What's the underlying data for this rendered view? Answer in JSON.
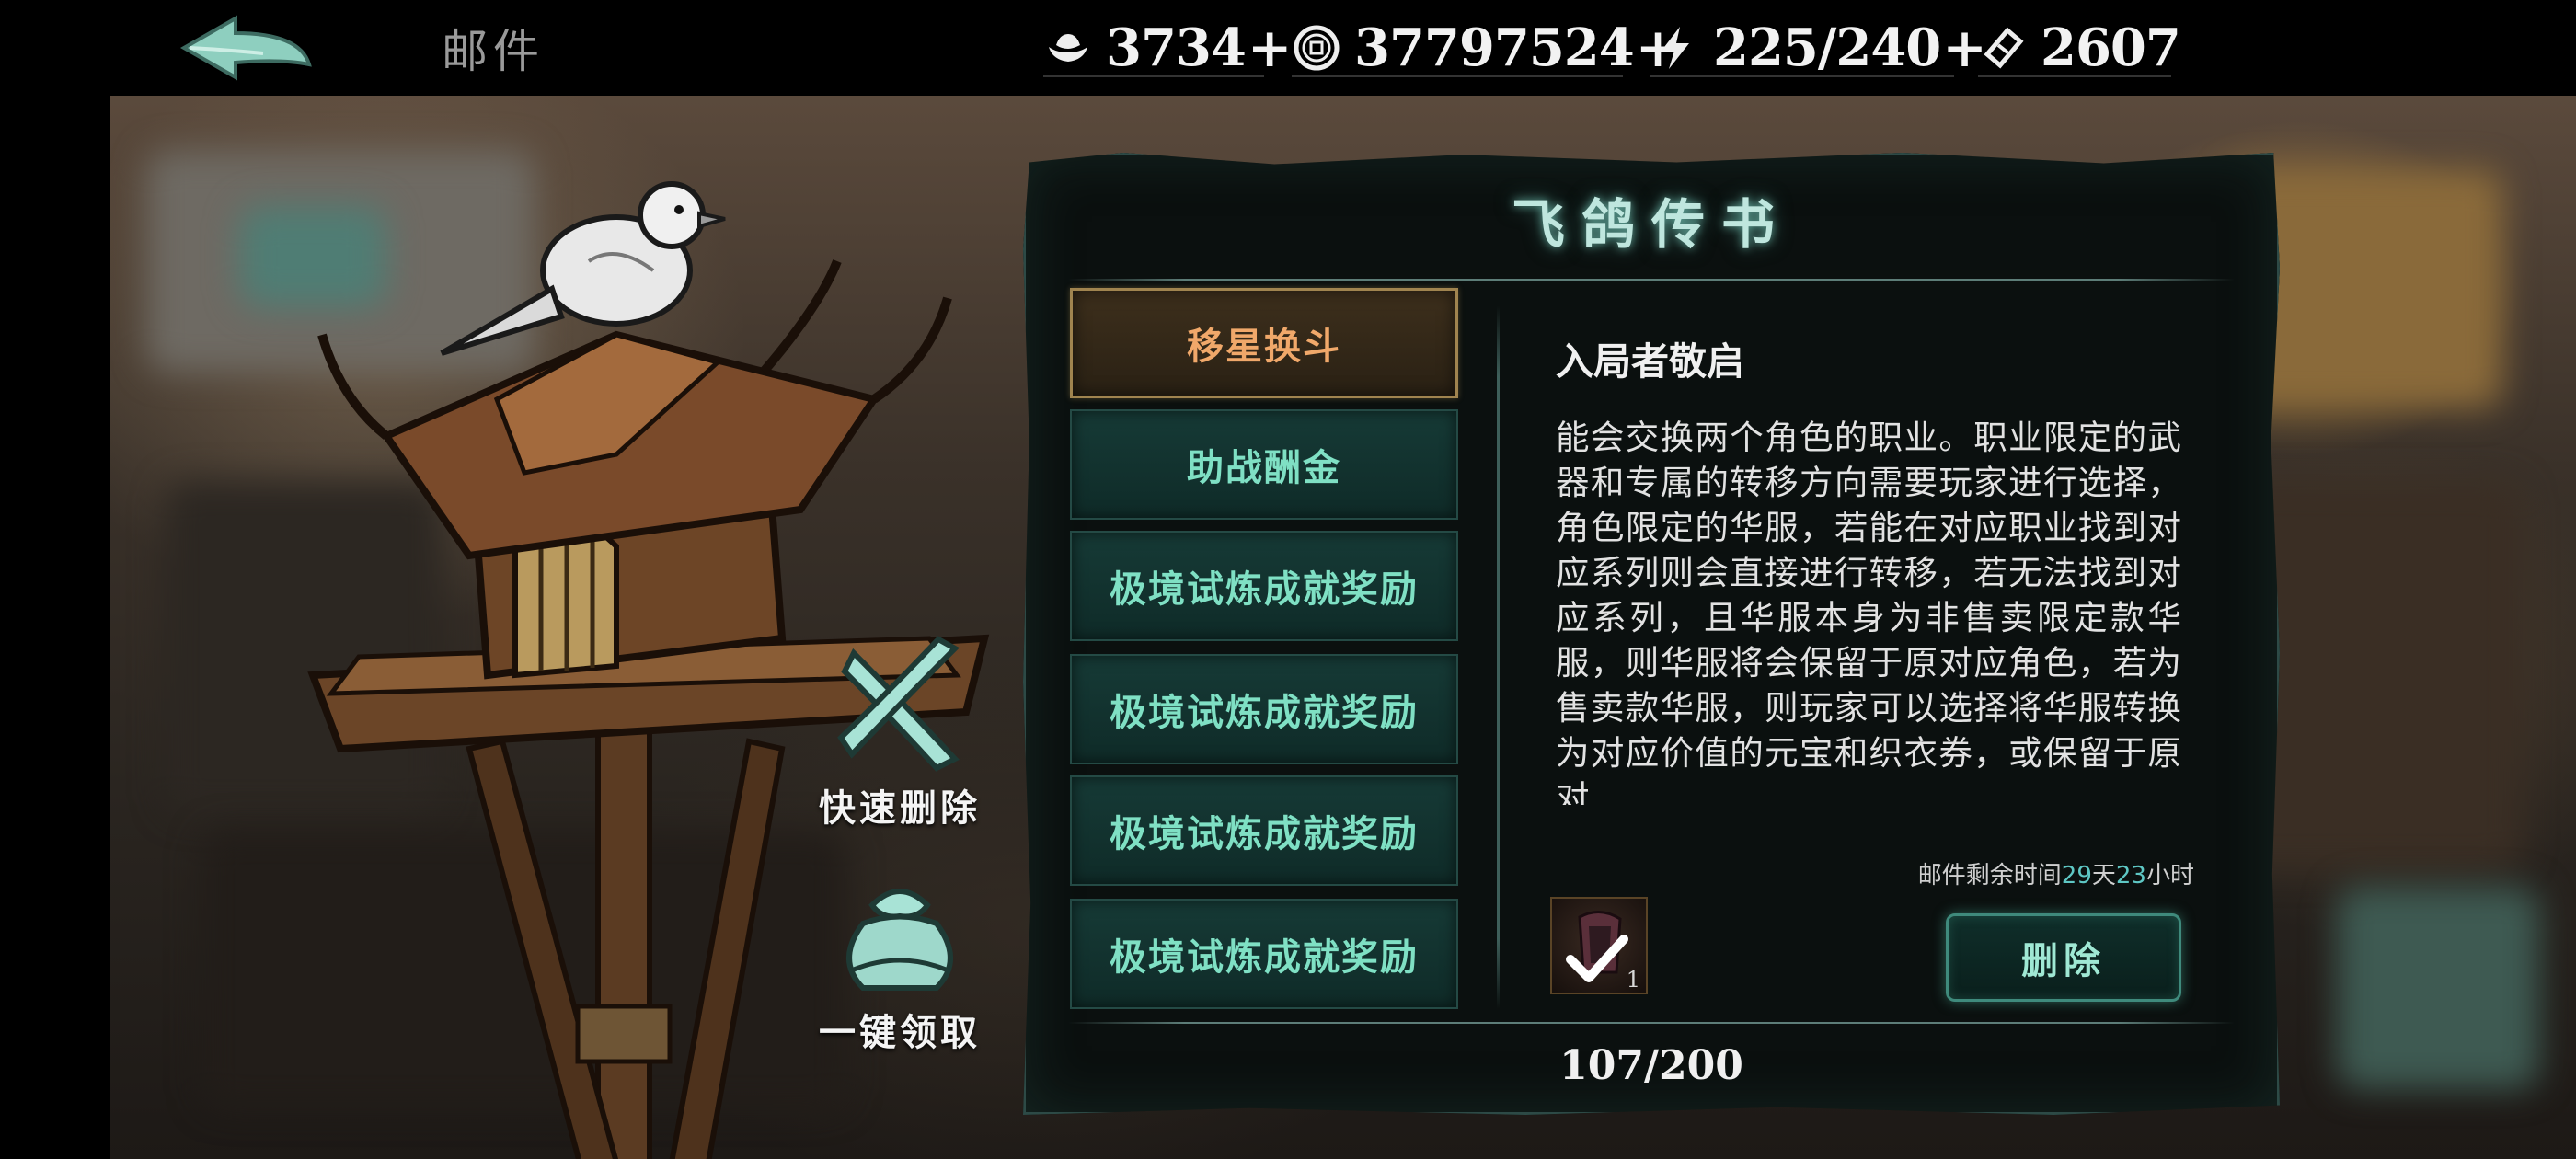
{
  "header": {
    "title": "邮件",
    "resources": [
      {
        "icon": "ingot-icon",
        "value": "3734"
      },
      {
        "icon": "coin-icon",
        "value": "37797524"
      },
      {
        "icon": "lightning-icon",
        "value": "225/240"
      },
      {
        "icon": "ticket-icon",
        "value": "2607"
      }
    ]
  },
  "panel": {
    "title": "飞鸽传书",
    "mail_items": [
      {
        "label": "移星换斗",
        "active": true
      },
      {
        "label": "助战酬金",
        "active": false
      },
      {
        "label": "极境试炼成就奖励",
        "active": false
      },
      {
        "label": "极境试炼成就奖励",
        "active": false
      },
      {
        "label": "极境试炼成就奖励",
        "active": false
      },
      {
        "label": "极境试炼成就奖励",
        "active": false
      }
    ],
    "mail": {
      "heading": "入局者敬启",
      "body": "能会交换两个角色的职业。职业限定的武器和专属的转移方向需要玩家进行选择，角色限定的华服，若能在对应职业找到对应系列则会直接进行转移，若无法找到对应系列，且华服本身为非售卖限定款华服，则华服将会保留于原对应角色，若为售卖款华服，则玩家可以选择将华服转换为对应价值的元宝和织衣券，或保留于原对",
      "expire_prefix": "邮件剩余时间",
      "expire_days": "29",
      "expire_day_unit": "天",
      "expire_hours": "23",
      "expire_hour_unit": "小时",
      "attachment_count": "1",
      "delete_label": "删除"
    },
    "counter": "107/200"
  },
  "actions": {
    "quick_delete": "快速删除",
    "claim_all": "一键领取"
  },
  "colors": {
    "accent_teal": "#7fe0c4",
    "active_orange": "#f0a86a",
    "expire_highlight": "#5ec7c4"
  }
}
